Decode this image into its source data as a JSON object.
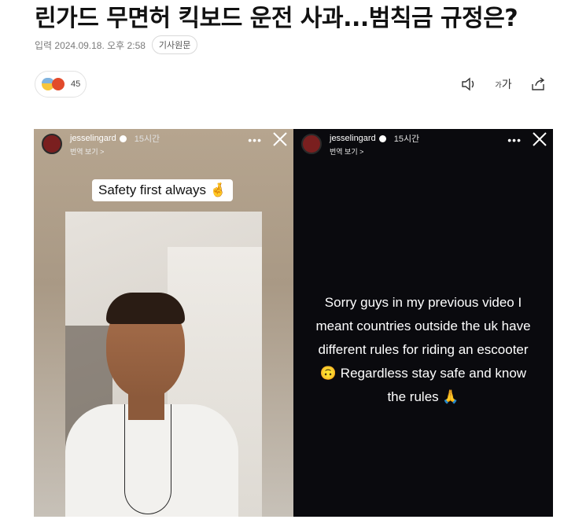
{
  "article": {
    "headline": "린가드 무면허 킥보드 운전 사과...범칙금 규정은?",
    "published": "입력 2024.09.18. 오후 2:58",
    "source_button": "기사원문"
  },
  "reactions": {
    "icons": [
      "sad-emoji-icon",
      "angry-emoji-icon"
    ],
    "count": "45"
  },
  "toolbar": {
    "audio_icon": "speaker-icon",
    "font_small": "가",
    "font_large": "가",
    "share_icon": "share-icon"
  },
  "stories": [
    {
      "username": "jesselingard",
      "time": "15시간",
      "translate": "번역 보기 >",
      "menu": "•••",
      "caption": "Safety first always 🤞"
    },
    {
      "username": "jesselingard",
      "time": "15시간",
      "translate": "번역 보기 >",
      "menu": "•••",
      "lines": [
        "Sorry guys in my previous video I",
        "meant countries outside the uk have",
        "different rules for riding an escooter",
        "🙃 Regardless stay safe and know",
        "the rules 🙏"
      ]
    }
  ],
  "colors": {
    "meta_text": "#7a7a7a",
    "right_story_bg": "#0a0a0e"
  }
}
